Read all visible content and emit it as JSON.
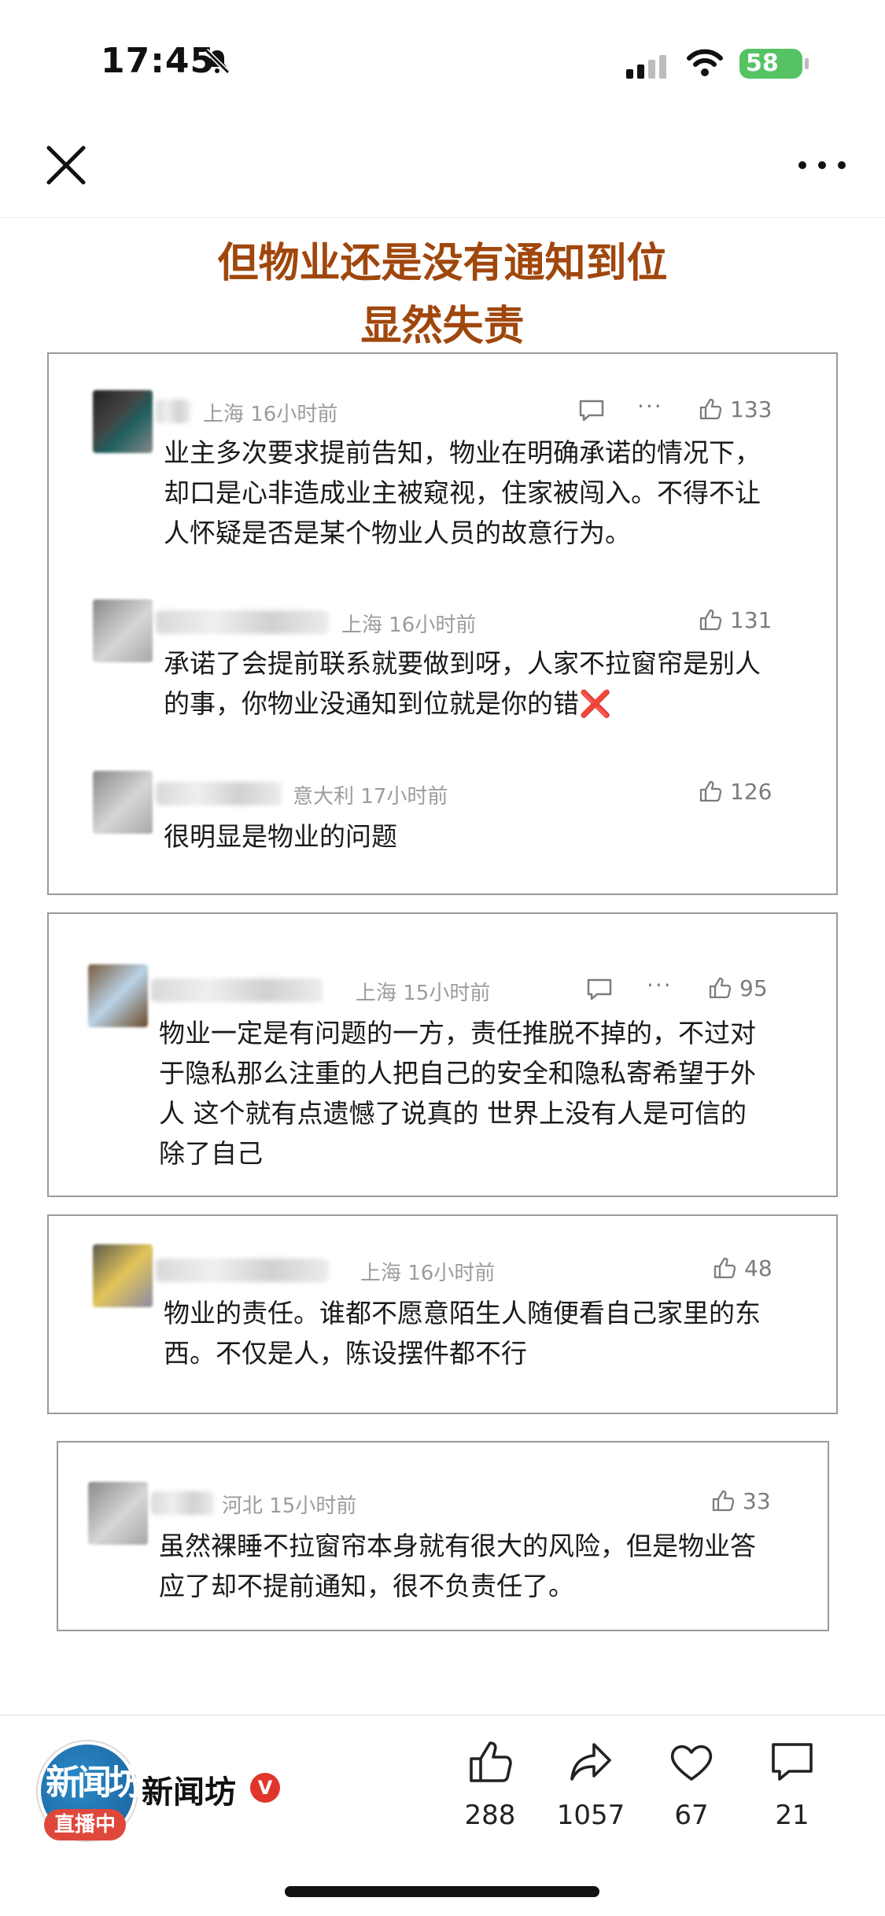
{
  "status_bar": {
    "time": "17:45",
    "battery": "58"
  },
  "headline": {
    "line1": "但物业还是没有通知到位",
    "line2": "显然失责"
  },
  "comments": [
    {
      "meta": "上海 16小时前",
      "likes": "133",
      "text": "业主多次要求提前告知，物业在明确承诺的情况下，却口是心非造成业主被窥视，住家被闯入。不得不让人怀疑是否是某个物业人员的故意行为。"
    },
    {
      "meta": "上海 16小时前",
      "likes": "131",
      "text": "承诺了会提前联系就要做到呀，人家不拉窗帘是别人的事，你物业没通知到位就是你的错",
      "emoji": "❌"
    },
    {
      "meta": "意大利 17小时前",
      "likes": "126",
      "text": "很明显是物业的问题"
    },
    {
      "meta": "上海 15小时前",
      "likes": "95",
      "text": "物业一定是有问题的一方，责任推脱不掉的，不过对于隐私那么注重的人把自己的安全和隐私寄希望于外人 这个就有点遗憾了说真的 世界上没有人是可信的 除了自己"
    },
    {
      "meta": "上海 16小时前",
      "likes": "48",
      "text": "物业的责任。谁都不愿意陌生人随便看自己家里的东西。不仅是人，陈设摆件都不行"
    },
    {
      "meta": "河北 15小时前",
      "likes": "33",
      "text": "虽然裸睡不拉窗帘本身就有很大的风险，但是物业答应了却不提前通知，很不负责任了。"
    }
  ],
  "bottom_bar": {
    "logo_text": "新闻坊",
    "live_badge": "直播中",
    "channel_name": "新闻坊",
    "verified_mark": "V",
    "stats": {
      "likes": "288",
      "shares": "1057",
      "favorites": "67",
      "comments": "21"
    }
  }
}
